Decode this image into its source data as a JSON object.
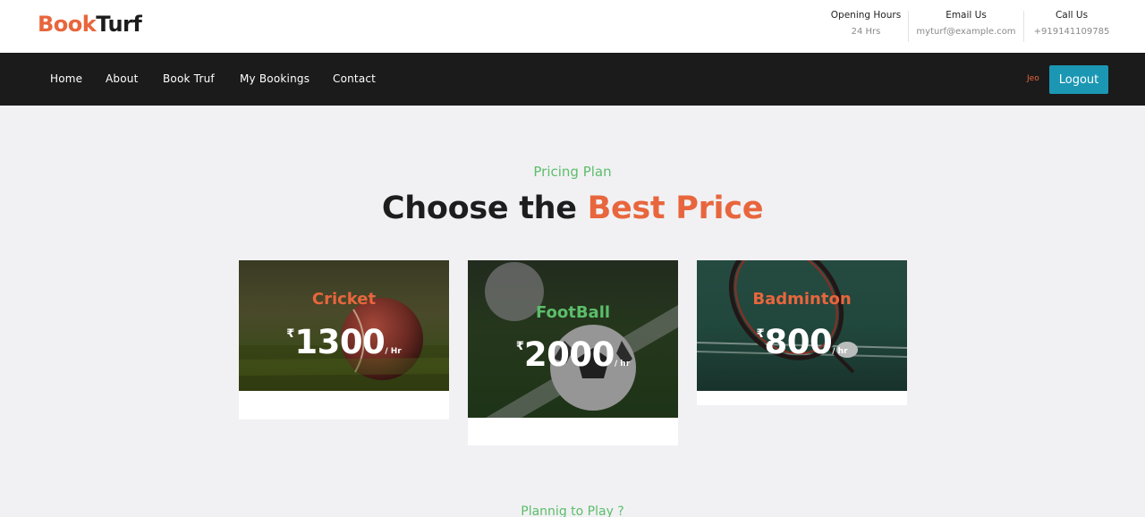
{
  "brand": {
    "part1": "Book",
    "part2": "Turf"
  },
  "header_info": [
    {
      "title": "Opening Hours",
      "value": "24 Hrs"
    },
    {
      "title": "Email Us",
      "value": "myturf@example.com"
    },
    {
      "title": "Call Us",
      "value": "+919141109785"
    }
  ],
  "nav": {
    "items": [
      "Home",
      "About",
      "Book Truf",
      "My Bookings",
      "Contact"
    ],
    "user": "Jeo",
    "logout_label": "Logout"
  },
  "pricing": {
    "kicker": "Pricing Plan",
    "heading_part1": "Choose the ",
    "heading_part2": "Best Price",
    "plans": [
      {
        "name": "Cricket",
        "currency": "₹",
        "amount": "1300",
        "per": "/ Hr",
        "name_color": "#e8663d"
      },
      {
        "name": "FootBall",
        "currency": "₹",
        "amount": "2000",
        "per": "/ hr",
        "name_color": "#5cbd6a"
      },
      {
        "name": "Badminton",
        "currency": "₹",
        "amount": "800",
        "per": "/ hr",
        "name_color": "#e8663d"
      }
    ]
  },
  "bottom_kicker": "Plannig to Play ?",
  "colors": {
    "accent": "#e8663d",
    "green": "#5cbd6a",
    "nav_bg": "#1b1b1b",
    "button": "#1b97b3"
  }
}
